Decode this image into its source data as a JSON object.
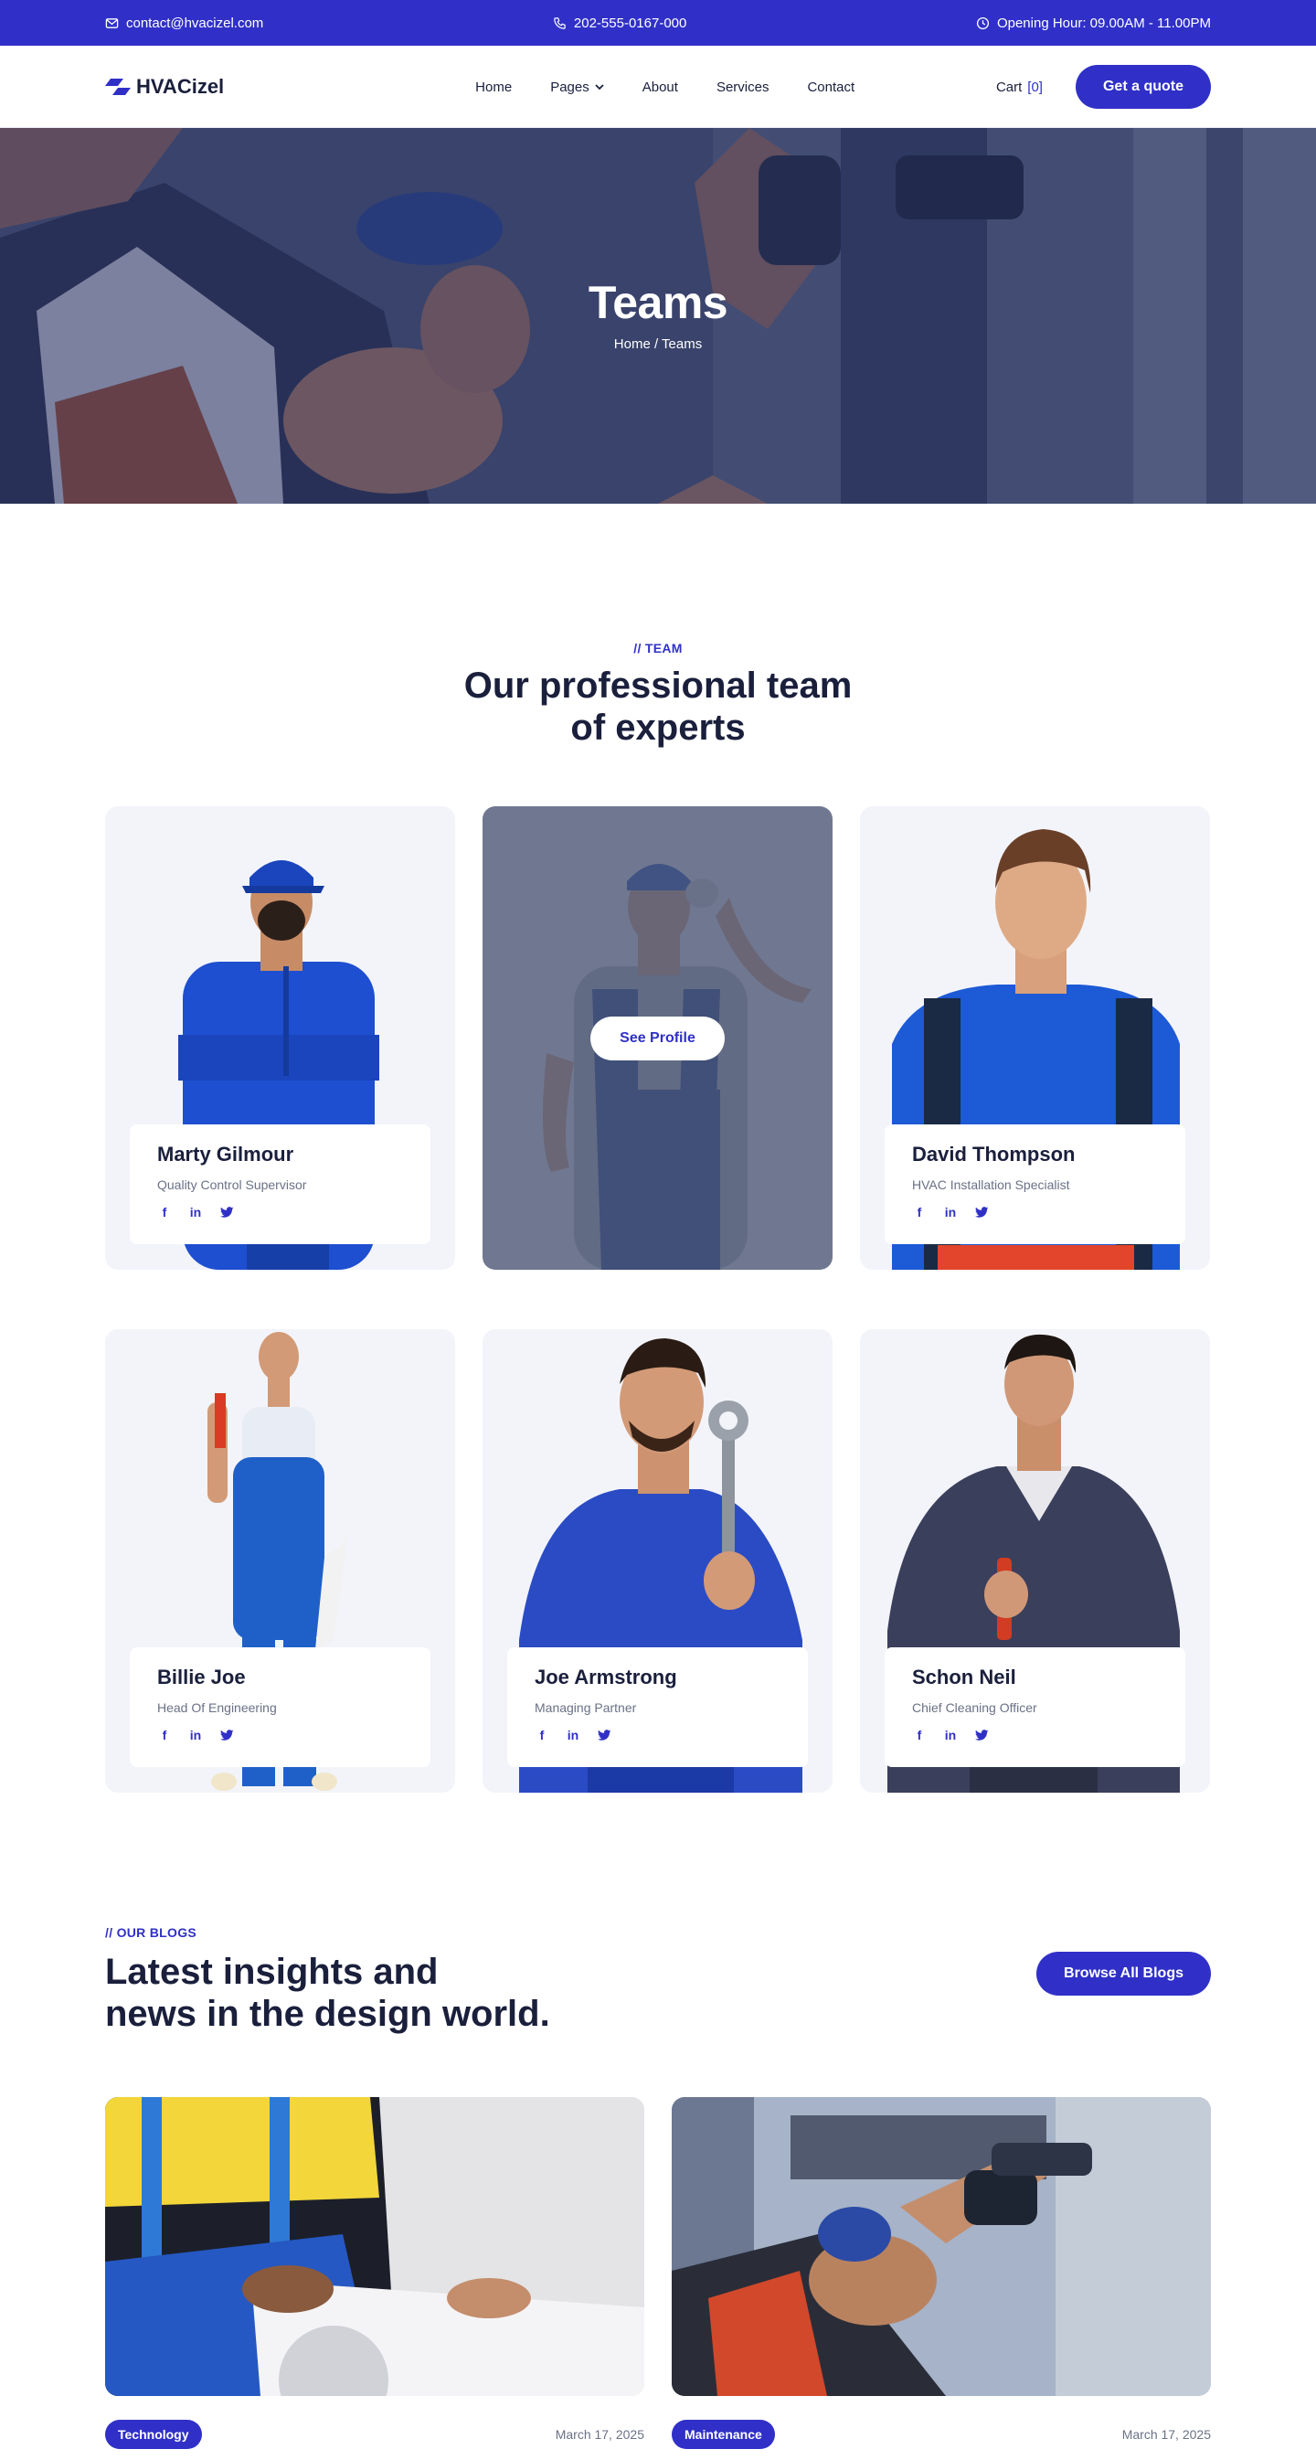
{
  "topbar": {
    "email": "contact@hvacizel.com",
    "phone": "202-555-0167-000",
    "hours": "Opening Hour: 09.00AM - 11.00PM"
  },
  "nav": {
    "logo": "HVACizel",
    "items": [
      "Home",
      "Pages",
      "About",
      "Services",
      "Contact"
    ],
    "cart_label": "Cart",
    "cart_count": "[0]",
    "quote_button": "Get a quote"
  },
  "hero": {
    "title": "Teams",
    "breadcrumb": "Home / Teams"
  },
  "team": {
    "eyebrow": "// TEAM",
    "title_line1": "Our professional team",
    "title_line2": "of experts",
    "see_profile": "See Profile",
    "members": [
      {
        "name": "Marty Gilmour",
        "role": "Quality Control Supervisor"
      },
      {
        "name": "",
        "role": ""
      },
      {
        "name": "David Thompson",
        "role": "HVAC Installation Specialist"
      },
      {
        "name": "Billie Joe",
        "role": "Head Of Engineering"
      },
      {
        "name": "Joe Armstrong",
        "role": "Managing Partner"
      },
      {
        "name": "Schon Neil",
        "role": "Chief Cleaning Officer"
      }
    ],
    "social_icons": [
      "facebook-icon",
      "linkedin-icon",
      "twitter-icon"
    ]
  },
  "blogs": {
    "eyebrow": "// OUR BLOGS",
    "title_line1": "Latest insights and",
    "title_line2": "news in the design world.",
    "browse_button": "Browse All Blogs",
    "posts": [
      {
        "tag": "Technology",
        "date": "March 17, 2025"
      },
      {
        "tag": "Maintenance",
        "date": "March 17, 2025"
      }
    ]
  },
  "colors": {
    "primary": "#3030c8",
    "heading": "#1a1f3c",
    "card_bg": "#f3f4fa"
  }
}
